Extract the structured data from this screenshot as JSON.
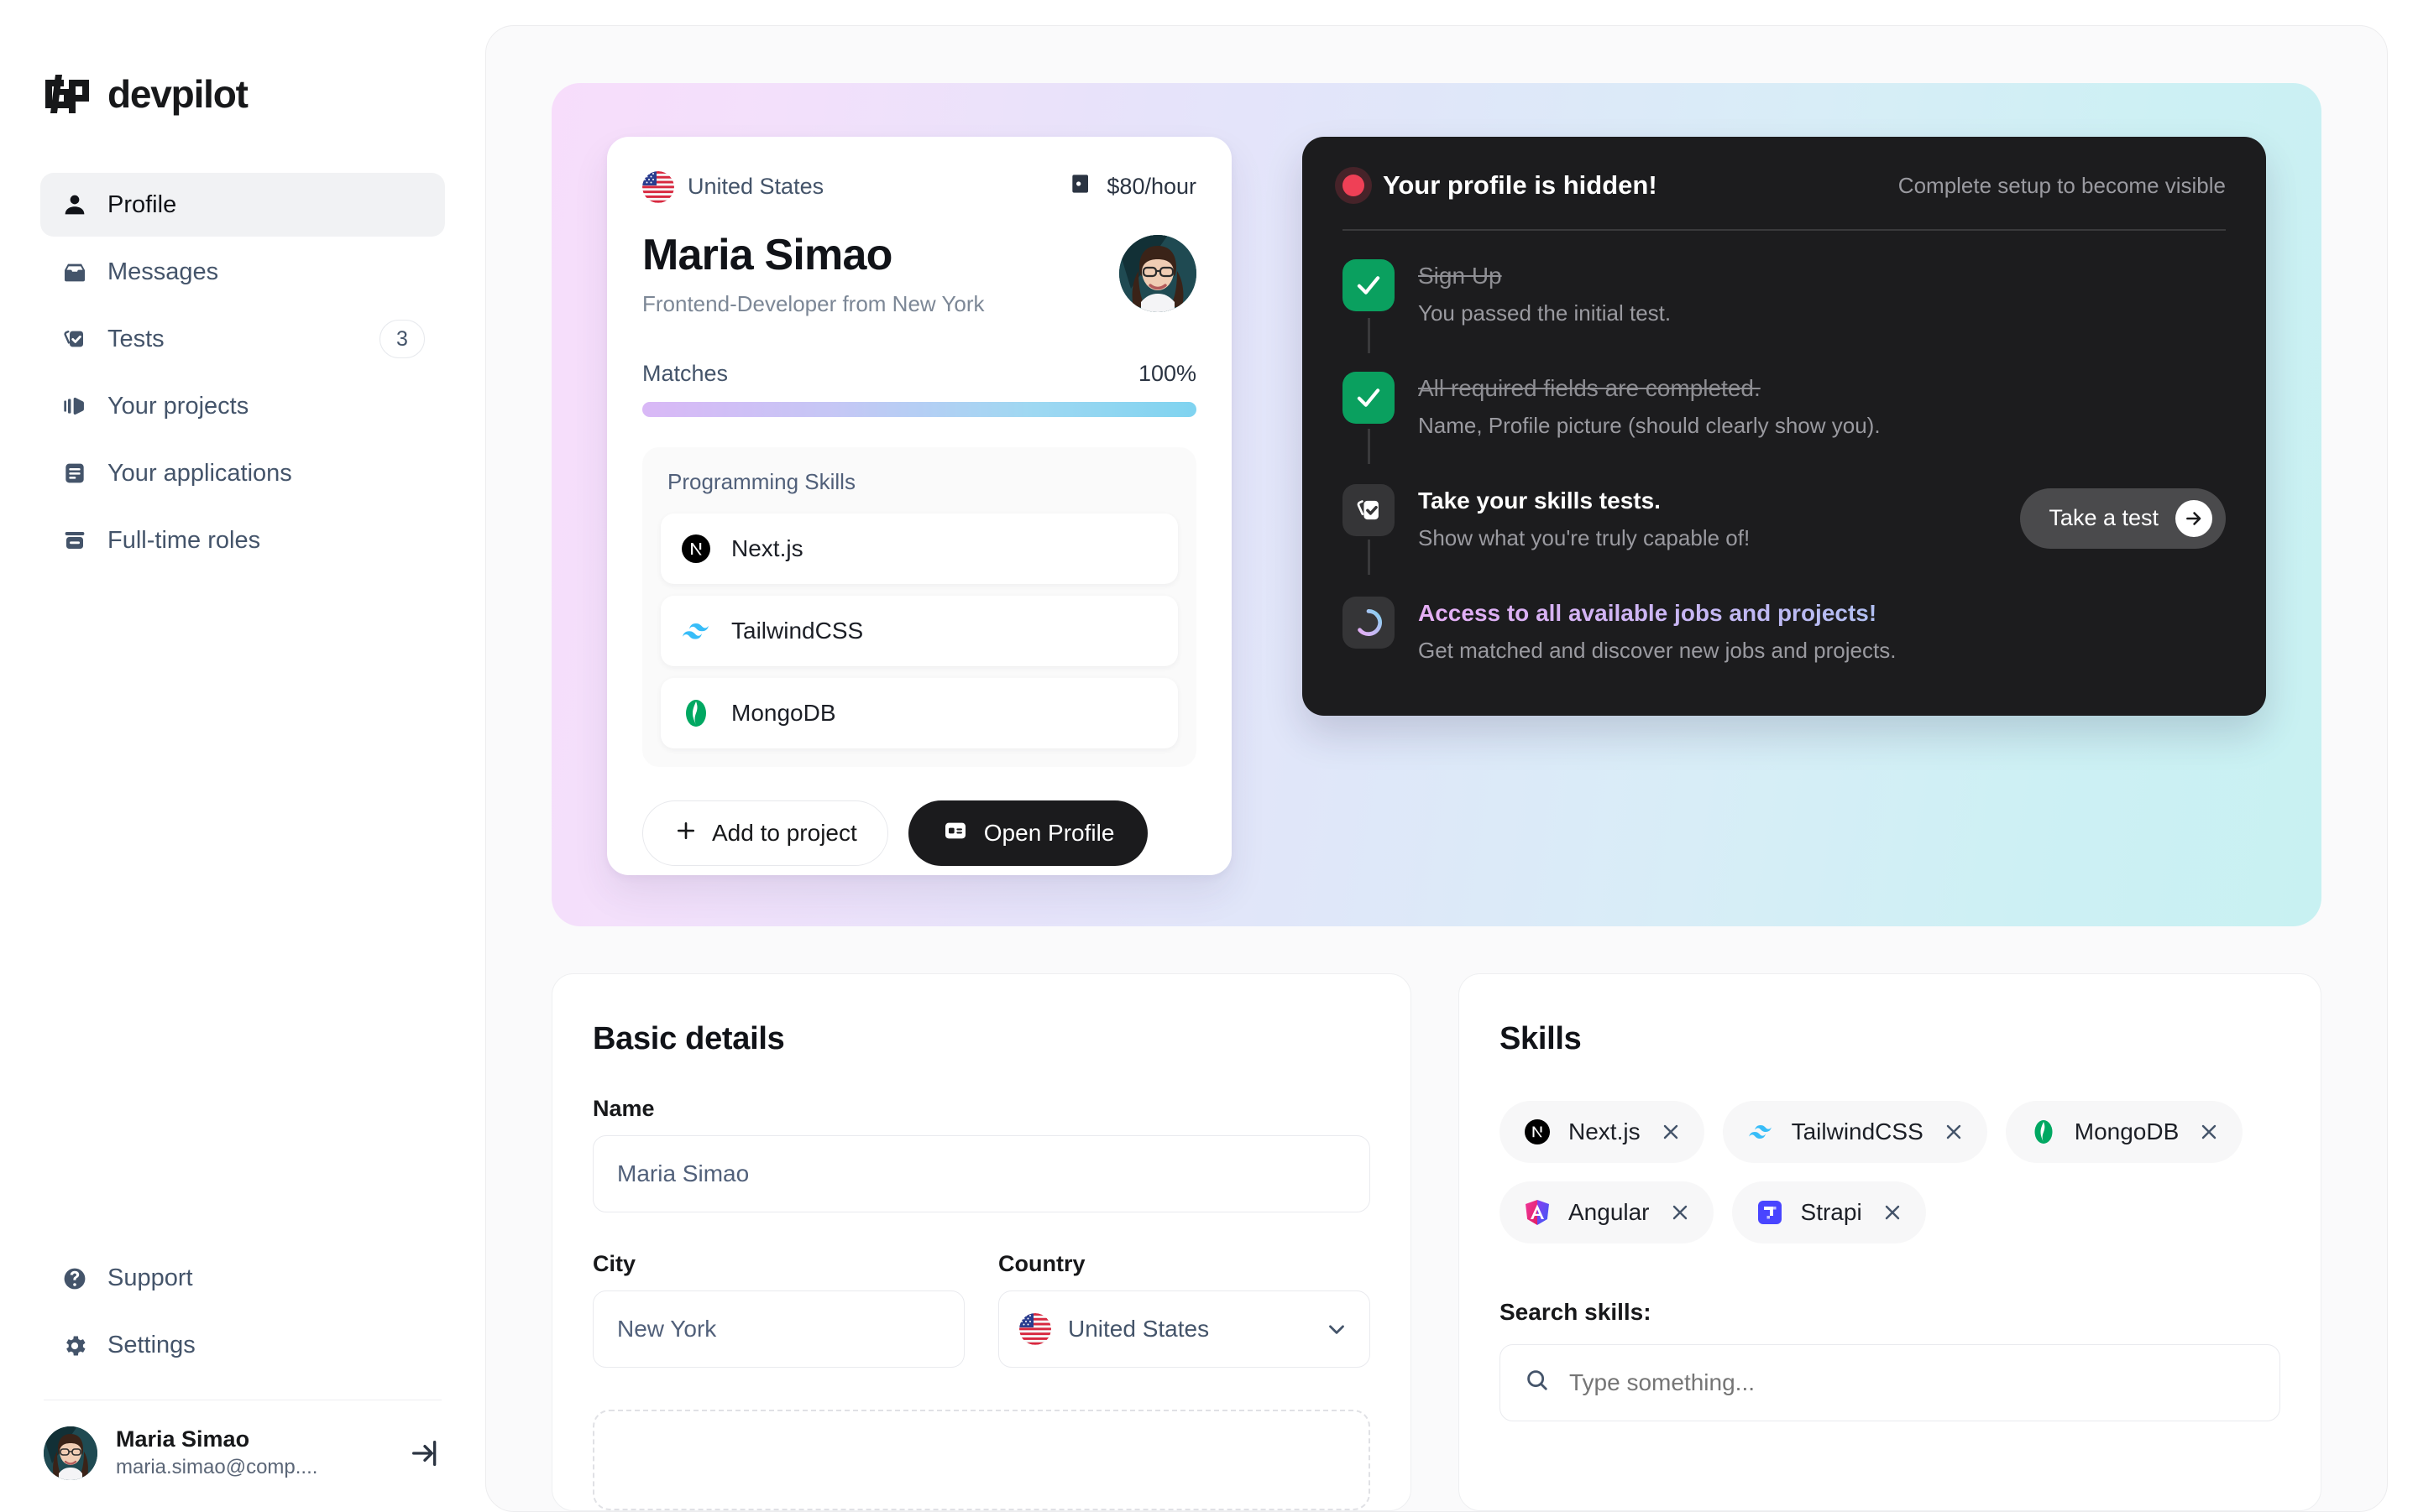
{
  "brand": {
    "name": "devpilot"
  },
  "sidebar": {
    "nav": [
      {
        "label": "Profile",
        "icon": "user-icon",
        "active": true
      },
      {
        "label": "Messages",
        "icon": "inbox-icon",
        "active": false
      },
      {
        "label": "Tests",
        "icon": "tests-icon",
        "active": false,
        "badge": "3"
      },
      {
        "label": "Your projects",
        "icon": "projects-icon",
        "active": false
      },
      {
        "label": "Your applications",
        "icon": "applications-icon",
        "active": false
      },
      {
        "label": "Full-time roles",
        "icon": "roles-icon",
        "active": false
      }
    ],
    "bottom": [
      {
        "label": "Support",
        "icon": "help-circle-icon"
      },
      {
        "label": "Settings",
        "icon": "gear-icon"
      }
    ],
    "user": {
      "name": "Maria Simao",
      "email": "maria.simao@comp....",
      "logout_icon": "logout-icon"
    }
  },
  "profile_card": {
    "country": "United States",
    "country_flag": "us-flag-icon",
    "rate": "$80/hour",
    "rate_icon": "wallet-icon",
    "name": "Maria Simao",
    "role": "Frontend-Developer from New York",
    "matches_label": "Matches",
    "matches_value": "100%",
    "matches_percent": 100,
    "skills_title": "Programming Skills",
    "skills": [
      {
        "name": "Next.js",
        "icon": "nextjs-icon"
      },
      {
        "name": "TailwindCSS",
        "icon": "tailwindcss-icon"
      },
      {
        "name": "MongoDB",
        "icon": "mongodb-icon"
      }
    ],
    "add_button": "Add to project",
    "open_button": "Open Profile"
  },
  "status_panel": {
    "title": "Your profile is hidden!",
    "subtitle": "Complete setup to become visible",
    "status_dot_color": "#ef4056",
    "items": [
      {
        "heading": "Sign Up",
        "description": "You passed the initial test.",
        "state": "done",
        "icon": "check-icon"
      },
      {
        "heading": "All required fields are completed.",
        "description": "Name, Profile picture (should clearly show you).",
        "state": "done",
        "icon": "check-icon"
      },
      {
        "heading": "Take your skills tests.",
        "description": "Show what you're truly capable of!",
        "state": "todo",
        "icon": "clipboard-check-icon",
        "cta": "Take a test"
      },
      {
        "heading": "Access to all available jobs and projects!",
        "description": "Get matched and discover new jobs and projects.",
        "state": "pending",
        "icon": "spinner-icon"
      }
    ]
  },
  "basic_details": {
    "title": "Basic details",
    "name_label": "Name",
    "name_value": "Maria Simao",
    "city_label": "City",
    "city_value": "New York",
    "country_label": "Country",
    "country_value": "United States",
    "country_flag": "us-flag-icon",
    "chevron": "chevron-down-icon"
  },
  "skills_panel": {
    "title": "Skills",
    "chips": [
      {
        "name": "Next.js",
        "icon": "nextjs-icon",
        "remove": "close-icon"
      },
      {
        "name": "TailwindCSS",
        "icon": "tailwindcss-icon",
        "remove": "close-icon"
      },
      {
        "name": "MongoDB",
        "icon": "mongodb-icon",
        "remove": "close-icon"
      },
      {
        "name": "Angular",
        "icon": "angular-icon",
        "remove": "close-icon"
      },
      {
        "name": "Strapi",
        "icon": "strapi-icon",
        "remove": "close-icon"
      }
    ],
    "search_label": "Search skills:",
    "search_placeholder": "Type something...",
    "search_value": "",
    "search_icon": "search-icon"
  },
  "colors": {
    "accent_green": "#0aa05f",
    "accent_red": "#ef4056",
    "dark_panel": "#1c1c1e",
    "nav_active_bg": "#f1f2f4"
  }
}
